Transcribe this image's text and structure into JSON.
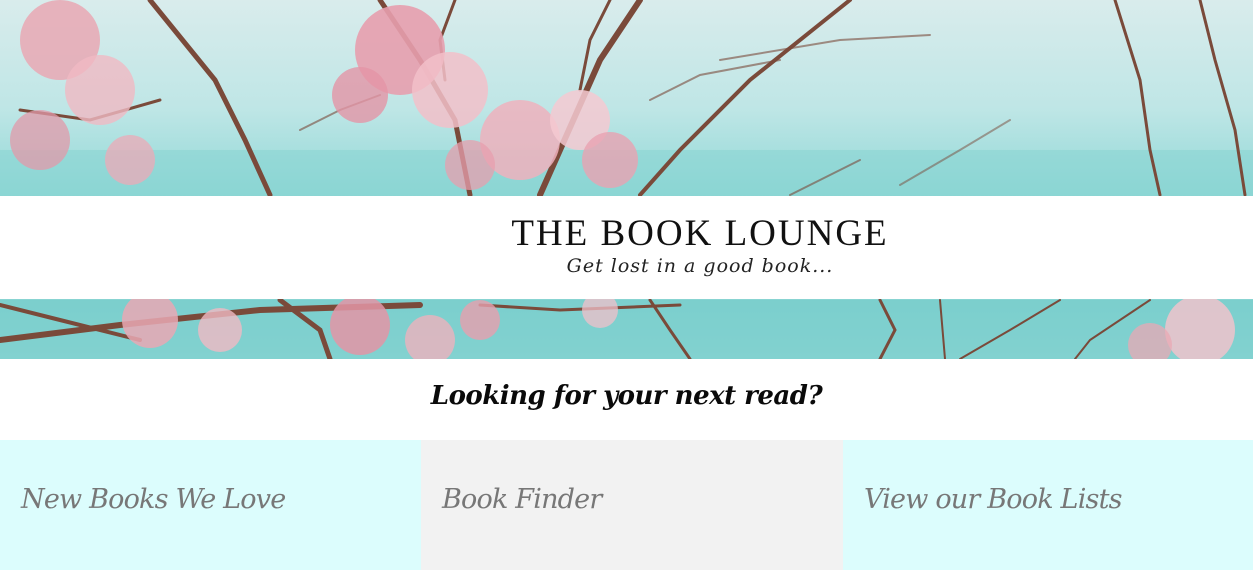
{
  "site": {
    "title": "THE BOOK LOUNGE",
    "tagline": "Get lost in a good book..."
  },
  "hero": {
    "icon": "cherry-blossom-branches-over-sea"
  },
  "prompt": {
    "heading": "Looking for your next read?"
  },
  "cards": [
    {
      "label": "New Books We Love",
      "background": "#dcfdfd"
    },
    {
      "label": "Book Finder",
      "background": "#f2f2f2"
    },
    {
      "label": "View our Book Lists",
      "background": "#dcfdfd"
    }
  ],
  "colors": {
    "sky": "#d9ecec",
    "sea": "#7fd0cf",
    "blossom": "#e9a8b4",
    "branch": "#7a4a3a"
  }
}
